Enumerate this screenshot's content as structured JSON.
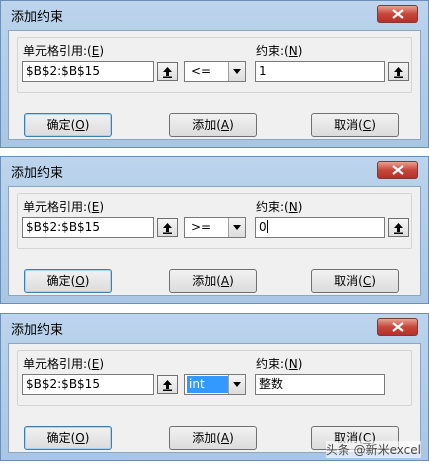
{
  "dialogs": [
    {
      "title": "添加约束",
      "cell_ref_label": "单元格引用:",
      "cell_ref_key": "E",
      "cell_ref_value": "$B$2:$B$15",
      "operator": "<=",
      "constraint_label": "约束:",
      "constraint_key": "N",
      "constraint_value": "1",
      "ok_label": "确定",
      "ok_key": "O",
      "add_label": "添加",
      "add_key": "A",
      "cancel_label": "取消",
      "cancel_key": "C"
    },
    {
      "title": "添加约束",
      "cell_ref_label": "单元格引用:",
      "cell_ref_key": "E",
      "cell_ref_value": "$B$2:$B$15",
      "operator": ">=",
      "constraint_label": "约束:",
      "constraint_key": "N",
      "constraint_value": "0",
      "ok_label": "确定",
      "ok_key": "O",
      "add_label": "添加",
      "add_key": "A",
      "cancel_label": "取消",
      "cancel_key": "C"
    },
    {
      "title": "添加约束",
      "cell_ref_label": "单元格引用:",
      "cell_ref_key": "E",
      "cell_ref_value": "$B$2:$B$15",
      "operator": "int",
      "constraint_label": "约束:",
      "constraint_key": "N",
      "constraint_value": "整数",
      "ok_label": "确定",
      "ok_key": "O",
      "add_label": "添加",
      "add_key": "A",
      "cancel_label": "取消",
      "cancel_key": "C"
    }
  ],
  "watermark": "头条 @新米excel",
  "colors": {
    "close_button": "#c6473a",
    "selection": "#3399ff",
    "default_button_border": "#3c7fb1"
  },
  "icons": {
    "close": "close-icon",
    "collapse": "collapse-dialog-icon",
    "dropdown": "chevron-down-icon"
  }
}
